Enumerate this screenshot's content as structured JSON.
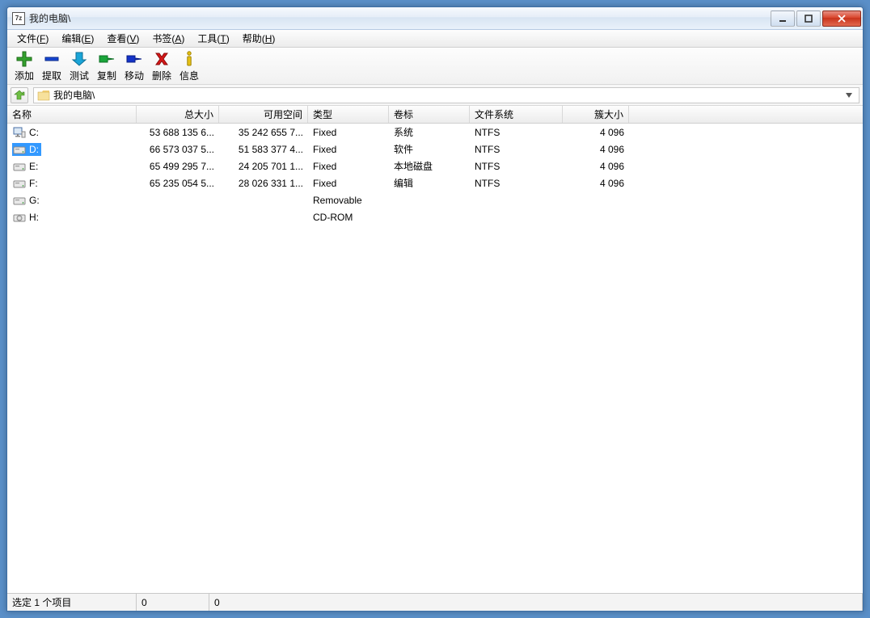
{
  "window": {
    "title": "我的电脑\\"
  },
  "menubar": {
    "items": [
      {
        "label": "文件",
        "accel": "F"
      },
      {
        "label": "编辑",
        "accel": "E"
      },
      {
        "label": "查看",
        "accel": "V"
      },
      {
        "label": "书签",
        "accel": "A"
      },
      {
        "label": "工具",
        "accel": "T"
      },
      {
        "label": "帮助",
        "accel": "H"
      }
    ]
  },
  "toolbar": {
    "items": [
      {
        "id": "add",
        "label": "添加"
      },
      {
        "id": "extract",
        "label": "提取"
      },
      {
        "id": "test",
        "label": "测试"
      },
      {
        "id": "copy",
        "label": "复制"
      },
      {
        "id": "move",
        "label": "移动"
      },
      {
        "id": "delete",
        "label": "删除"
      },
      {
        "id": "info",
        "label": "信息"
      }
    ]
  },
  "addressbar": {
    "path": "我的电脑\\"
  },
  "columns": [
    {
      "key": "name",
      "label": "名称",
      "cls": "col-name"
    },
    {
      "key": "size",
      "label": "总大小",
      "cls": "col-size num"
    },
    {
      "key": "free",
      "label": "可用空间",
      "cls": "col-free num"
    },
    {
      "key": "type",
      "label": "类型",
      "cls": "col-type"
    },
    {
      "key": "label",
      "label": "卷标",
      "cls": "col-label"
    },
    {
      "key": "fs",
      "label": "文件系统",
      "cls": "col-fs"
    },
    {
      "key": "cluster",
      "label": "簇大小",
      "cls": "col-cluster num"
    }
  ],
  "rows": [
    {
      "icon": "pc",
      "name": "C:",
      "size": "53 688 135 6...",
      "free": "35 242 655 7...",
      "type": "Fixed",
      "label": "系统",
      "fs": "NTFS",
      "cluster": "4 096",
      "selected": false
    },
    {
      "icon": "hdd",
      "name": "D:",
      "size": "66 573 037 5...",
      "free": "51 583 377 4...",
      "type": "Fixed",
      "label": "软件",
      "fs": "NTFS",
      "cluster": "4 096",
      "selected": true
    },
    {
      "icon": "hdd",
      "name": "E:",
      "size": "65 499 295 7...",
      "free": "24 205 701 1...",
      "type": "Fixed",
      "label": "本地磁盘",
      "fs": "NTFS",
      "cluster": "4 096",
      "selected": false
    },
    {
      "icon": "hdd",
      "name": "F:",
      "size": "65 235 054 5...",
      "free": "28 026 331 1...",
      "type": "Fixed",
      "label": "编辑",
      "fs": "NTFS",
      "cluster": "4 096",
      "selected": false
    },
    {
      "icon": "hdd",
      "name": "G:",
      "size": "",
      "free": "",
      "type": "Removable",
      "label": "",
      "fs": "",
      "cluster": "",
      "selected": false
    },
    {
      "icon": "cd",
      "name": "H:",
      "size": "",
      "free": "",
      "type": "CD-ROM",
      "label": "",
      "fs": "",
      "cluster": "",
      "selected": false
    }
  ],
  "statusbar": {
    "selection": "选定 1 个项目",
    "panel2": "0",
    "panel3": "0"
  }
}
